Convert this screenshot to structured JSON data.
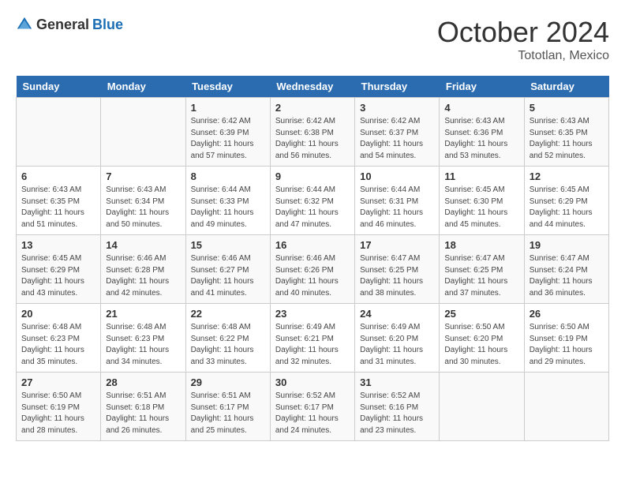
{
  "header": {
    "logo_general": "General",
    "logo_blue": "Blue",
    "month": "October 2024",
    "location": "Tototlan, Mexico"
  },
  "weekdays": [
    "Sunday",
    "Monday",
    "Tuesday",
    "Wednesday",
    "Thursday",
    "Friday",
    "Saturday"
  ],
  "weeks": [
    [
      null,
      null,
      {
        "day": 1,
        "sunrise": "6:42 AM",
        "sunset": "6:39 PM",
        "daylight": "11 hours and 57 minutes."
      },
      {
        "day": 2,
        "sunrise": "6:42 AM",
        "sunset": "6:38 PM",
        "daylight": "11 hours and 56 minutes."
      },
      {
        "day": 3,
        "sunrise": "6:42 AM",
        "sunset": "6:37 PM",
        "daylight": "11 hours and 54 minutes."
      },
      {
        "day": 4,
        "sunrise": "6:43 AM",
        "sunset": "6:36 PM",
        "daylight": "11 hours and 53 minutes."
      },
      {
        "day": 5,
        "sunrise": "6:43 AM",
        "sunset": "6:35 PM",
        "daylight": "11 hours and 52 minutes."
      }
    ],
    [
      {
        "day": 6,
        "sunrise": "6:43 AM",
        "sunset": "6:35 PM",
        "daylight": "11 hours and 51 minutes."
      },
      {
        "day": 7,
        "sunrise": "6:43 AM",
        "sunset": "6:34 PM",
        "daylight": "11 hours and 50 minutes."
      },
      {
        "day": 8,
        "sunrise": "6:44 AM",
        "sunset": "6:33 PM",
        "daylight": "11 hours and 49 minutes."
      },
      {
        "day": 9,
        "sunrise": "6:44 AM",
        "sunset": "6:32 PM",
        "daylight": "11 hours and 47 minutes."
      },
      {
        "day": 10,
        "sunrise": "6:44 AM",
        "sunset": "6:31 PM",
        "daylight": "11 hours and 46 minutes."
      },
      {
        "day": 11,
        "sunrise": "6:45 AM",
        "sunset": "6:30 PM",
        "daylight": "11 hours and 45 minutes."
      },
      {
        "day": 12,
        "sunrise": "6:45 AM",
        "sunset": "6:29 PM",
        "daylight": "11 hours and 44 minutes."
      }
    ],
    [
      {
        "day": 13,
        "sunrise": "6:45 AM",
        "sunset": "6:29 PM",
        "daylight": "11 hours and 43 minutes."
      },
      {
        "day": 14,
        "sunrise": "6:46 AM",
        "sunset": "6:28 PM",
        "daylight": "11 hours and 42 minutes."
      },
      {
        "day": 15,
        "sunrise": "6:46 AM",
        "sunset": "6:27 PM",
        "daylight": "11 hours and 41 minutes."
      },
      {
        "day": 16,
        "sunrise": "6:46 AM",
        "sunset": "6:26 PM",
        "daylight": "11 hours and 40 minutes."
      },
      {
        "day": 17,
        "sunrise": "6:47 AM",
        "sunset": "6:25 PM",
        "daylight": "11 hours and 38 minutes."
      },
      {
        "day": 18,
        "sunrise": "6:47 AM",
        "sunset": "6:25 PM",
        "daylight": "11 hours and 37 minutes."
      },
      {
        "day": 19,
        "sunrise": "6:47 AM",
        "sunset": "6:24 PM",
        "daylight": "11 hours and 36 minutes."
      }
    ],
    [
      {
        "day": 20,
        "sunrise": "6:48 AM",
        "sunset": "6:23 PM",
        "daylight": "11 hours and 35 minutes."
      },
      {
        "day": 21,
        "sunrise": "6:48 AM",
        "sunset": "6:23 PM",
        "daylight": "11 hours and 34 minutes."
      },
      {
        "day": 22,
        "sunrise": "6:48 AM",
        "sunset": "6:22 PM",
        "daylight": "11 hours and 33 minutes."
      },
      {
        "day": 23,
        "sunrise": "6:49 AM",
        "sunset": "6:21 PM",
        "daylight": "11 hours and 32 minutes."
      },
      {
        "day": 24,
        "sunrise": "6:49 AM",
        "sunset": "6:20 PM",
        "daylight": "11 hours and 31 minutes."
      },
      {
        "day": 25,
        "sunrise": "6:50 AM",
        "sunset": "6:20 PM",
        "daylight": "11 hours and 30 minutes."
      },
      {
        "day": 26,
        "sunrise": "6:50 AM",
        "sunset": "6:19 PM",
        "daylight": "11 hours and 29 minutes."
      }
    ],
    [
      {
        "day": 27,
        "sunrise": "6:50 AM",
        "sunset": "6:19 PM",
        "daylight": "11 hours and 28 minutes."
      },
      {
        "day": 28,
        "sunrise": "6:51 AM",
        "sunset": "6:18 PM",
        "daylight": "11 hours and 26 minutes."
      },
      {
        "day": 29,
        "sunrise": "6:51 AM",
        "sunset": "6:17 PM",
        "daylight": "11 hours and 25 minutes."
      },
      {
        "day": 30,
        "sunrise": "6:52 AM",
        "sunset": "6:17 PM",
        "daylight": "11 hours and 24 minutes."
      },
      {
        "day": 31,
        "sunrise": "6:52 AM",
        "sunset": "6:16 PM",
        "daylight": "11 hours and 23 minutes."
      },
      null,
      null
    ]
  ]
}
